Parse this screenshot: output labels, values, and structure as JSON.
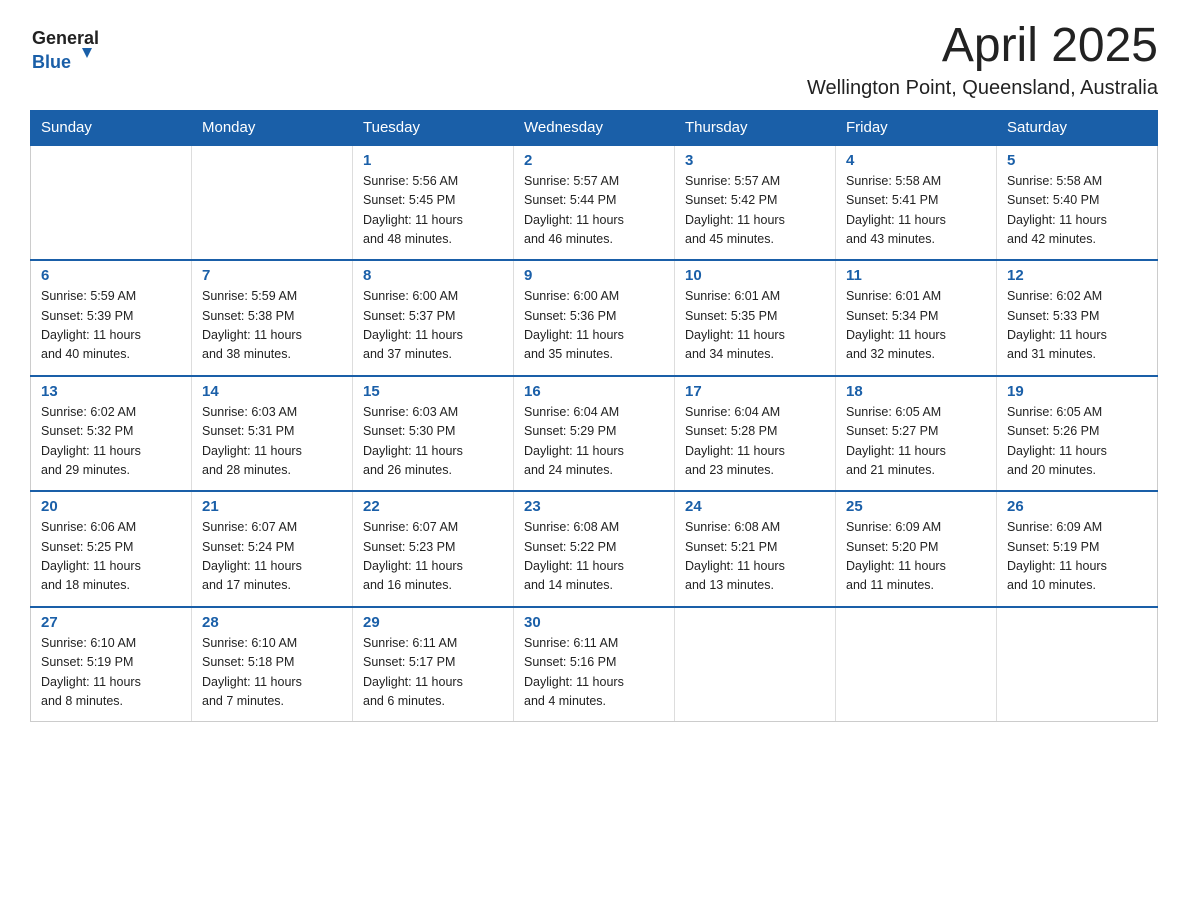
{
  "logo": {
    "general": "General",
    "blue": "Blue"
  },
  "header": {
    "month_year": "April 2025",
    "location": "Wellington Point, Queensland, Australia"
  },
  "weekdays": [
    "Sunday",
    "Monday",
    "Tuesday",
    "Wednesday",
    "Thursday",
    "Friday",
    "Saturday"
  ],
  "weeks": [
    [
      {
        "day": "",
        "info": ""
      },
      {
        "day": "",
        "info": ""
      },
      {
        "day": "1",
        "info": "Sunrise: 5:56 AM\nSunset: 5:45 PM\nDaylight: 11 hours\nand 48 minutes."
      },
      {
        "day": "2",
        "info": "Sunrise: 5:57 AM\nSunset: 5:44 PM\nDaylight: 11 hours\nand 46 minutes."
      },
      {
        "day": "3",
        "info": "Sunrise: 5:57 AM\nSunset: 5:42 PM\nDaylight: 11 hours\nand 45 minutes."
      },
      {
        "day": "4",
        "info": "Sunrise: 5:58 AM\nSunset: 5:41 PM\nDaylight: 11 hours\nand 43 minutes."
      },
      {
        "day": "5",
        "info": "Sunrise: 5:58 AM\nSunset: 5:40 PM\nDaylight: 11 hours\nand 42 minutes."
      }
    ],
    [
      {
        "day": "6",
        "info": "Sunrise: 5:59 AM\nSunset: 5:39 PM\nDaylight: 11 hours\nand 40 minutes."
      },
      {
        "day": "7",
        "info": "Sunrise: 5:59 AM\nSunset: 5:38 PM\nDaylight: 11 hours\nand 38 minutes."
      },
      {
        "day": "8",
        "info": "Sunrise: 6:00 AM\nSunset: 5:37 PM\nDaylight: 11 hours\nand 37 minutes."
      },
      {
        "day": "9",
        "info": "Sunrise: 6:00 AM\nSunset: 5:36 PM\nDaylight: 11 hours\nand 35 minutes."
      },
      {
        "day": "10",
        "info": "Sunrise: 6:01 AM\nSunset: 5:35 PM\nDaylight: 11 hours\nand 34 minutes."
      },
      {
        "day": "11",
        "info": "Sunrise: 6:01 AM\nSunset: 5:34 PM\nDaylight: 11 hours\nand 32 minutes."
      },
      {
        "day": "12",
        "info": "Sunrise: 6:02 AM\nSunset: 5:33 PM\nDaylight: 11 hours\nand 31 minutes."
      }
    ],
    [
      {
        "day": "13",
        "info": "Sunrise: 6:02 AM\nSunset: 5:32 PM\nDaylight: 11 hours\nand 29 minutes."
      },
      {
        "day": "14",
        "info": "Sunrise: 6:03 AM\nSunset: 5:31 PM\nDaylight: 11 hours\nand 28 minutes."
      },
      {
        "day": "15",
        "info": "Sunrise: 6:03 AM\nSunset: 5:30 PM\nDaylight: 11 hours\nand 26 minutes."
      },
      {
        "day": "16",
        "info": "Sunrise: 6:04 AM\nSunset: 5:29 PM\nDaylight: 11 hours\nand 24 minutes."
      },
      {
        "day": "17",
        "info": "Sunrise: 6:04 AM\nSunset: 5:28 PM\nDaylight: 11 hours\nand 23 minutes."
      },
      {
        "day": "18",
        "info": "Sunrise: 6:05 AM\nSunset: 5:27 PM\nDaylight: 11 hours\nand 21 minutes."
      },
      {
        "day": "19",
        "info": "Sunrise: 6:05 AM\nSunset: 5:26 PM\nDaylight: 11 hours\nand 20 minutes."
      }
    ],
    [
      {
        "day": "20",
        "info": "Sunrise: 6:06 AM\nSunset: 5:25 PM\nDaylight: 11 hours\nand 18 minutes."
      },
      {
        "day": "21",
        "info": "Sunrise: 6:07 AM\nSunset: 5:24 PM\nDaylight: 11 hours\nand 17 minutes."
      },
      {
        "day": "22",
        "info": "Sunrise: 6:07 AM\nSunset: 5:23 PM\nDaylight: 11 hours\nand 16 minutes."
      },
      {
        "day": "23",
        "info": "Sunrise: 6:08 AM\nSunset: 5:22 PM\nDaylight: 11 hours\nand 14 minutes."
      },
      {
        "day": "24",
        "info": "Sunrise: 6:08 AM\nSunset: 5:21 PM\nDaylight: 11 hours\nand 13 minutes."
      },
      {
        "day": "25",
        "info": "Sunrise: 6:09 AM\nSunset: 5:20 PM\nDaylight: 11 hours\nand 11 minutes."
      },
      {
        "day": "26",
        "info": "Sunrise: 6:09 AM\nSunset: 5:19 PM\nDaylight: 11 hours\nand 10 minutes."
      }
    ],
    [
      {
        "day": "27",
        "info": "Sunrise: 6:10 AM\nSunset: 5:19 PM\nDaylight: 11 hours\nand 8 minutes."
      },
      {
        "day": "28",
        "info": "Sunrise: 6:10 AM\nSunset: 5:18 PM\nDaylight: 11 hours\nand 7 minutes."
      },
      {
        "day": "29",
        "info": "Sunrise: 6:11 AM\nSunset: 5:17 PM\nDaylight: 11 hours\nand 6 minutes."
      },
      {
        "day": "30",
        "info": "Sunrise: 6:11 AM\nSunset: 5:16 PM\nDaylight: 11 hours\nand 4 minutes."
      },
      {
        "day": "",
        "info": ""
      },
      {
        "day": "",
        "info": ""
      },
      {
        "day": "",
        "info": ""
      }
    ]
  ]
}
